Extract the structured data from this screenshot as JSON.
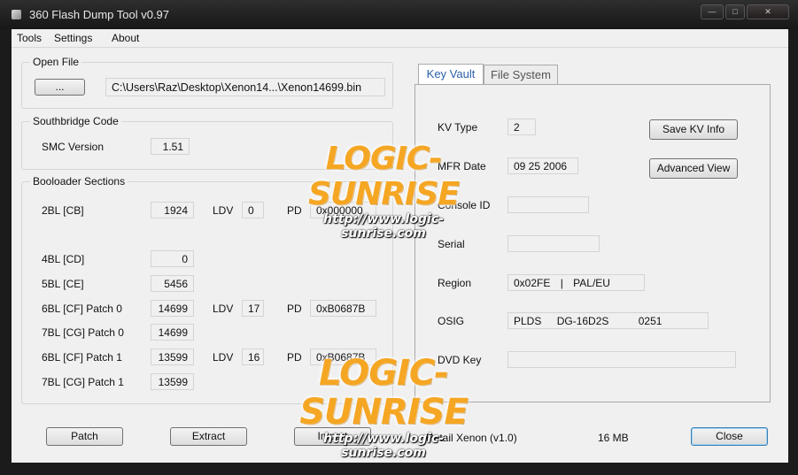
{
  "window": {
    "title": "360 Flash Dump Tool  v0.97"
  },
  "menu": {
    "items": [
      "Tools",
      "Settings",
      "About"
    ]
  },
  "open_file": {
    "label": "Open File",
    "browse_label": "...",
    "path": "C:\\Users\\Raz\\Desktop\\Xenon14...\\Xenon14699.bin"
  },
  "southbridge": {
    "label": "Southbridge Code",
    "smc_label": "SMC Version",
    "smc_value": "1.51"
  },
  "bootloader": {
    "label": "Booloader Sections",
    "rows": {
      "cb": {
        "label": "2BL [CB]",
        "value": "1924",
        "ldv_label": "LDV",
        "ldv": "0",
        "pd_label": "PD",
        "pd": "0x000000"
      },
      "cd": {
        "label": "4BL [CD]",
        "value": "0"
      },
      "ce": {
        "label": "5BL [CE]",
        "value": "5456"
      },
      "cf0": {
        "label": "6BL [CF] Patch 0",
        "value": "14699",
        "ldv_label": "LDV",
        "ldv": "17",
        "pd_label": "PD",
        "pd": "0xB0687B"
      },
      "cg0": {
        "label": "7BL [CG] Patch 0",
        "value": "14699"
      },
      "cf1": {
        "label": "6BL [CF] Patch 1",
        "value": "13599",
        "ldv_label": "LDV",
        "ldv": "16",
        "pd_label": "PD",
        "pd": "0xB0687B"
      },
      "cg1": {
        "label": "7BL [CG] Patch 1",
        "value": "13599"
      }
    }
  },
  "tabs": {
    "key_vault": "Key Vault",
    "file_system": "File System"
  },
  "key_vault": {
    "kv_type_label": "KV Type",
    "kv_type": "2",
    "mfr_date_label": "MFR Date",
    "mfr_date": "09 25 2006",
    "console_id_label": "Console ID",
    "console_id": "",
    "serial_label": "Serial",
    "serial": "",
    "region_label": "Region",
    "region_code": "0x02FE",
    "region_sep": "|",
    "region_name": "PAL/EU",
    "osig_label": "OSIG",
    "osig_vendor": "PLDS",
    "osig_model": "DG-16D2S",
    "osig_fw": "0251",
    "dvd_key_label": "DVD Key",
    "dvd_key": "",
    "save_kv_label": "Save KV Info",
    "advanced_label": "Advanced View"
  },
  "bottom": {
    "patch_label": "Patch",
    "extract_label": "Extract",
    "import_label": "Import",
    "status": "Retail Xenon (v1.0)",
    "size": "16 MB",
    "close_label": "Close"
  },
  "watermark": {
    "logo": "LOGIC-SUNRISE",
    "url": "http://www.logic-sunrise.com"
  },
  "colors": {
    "accent": "#2a5fa8",
    "watermark": "#f5a623",
    "chrome": "#1b1b1b"
  }
}
